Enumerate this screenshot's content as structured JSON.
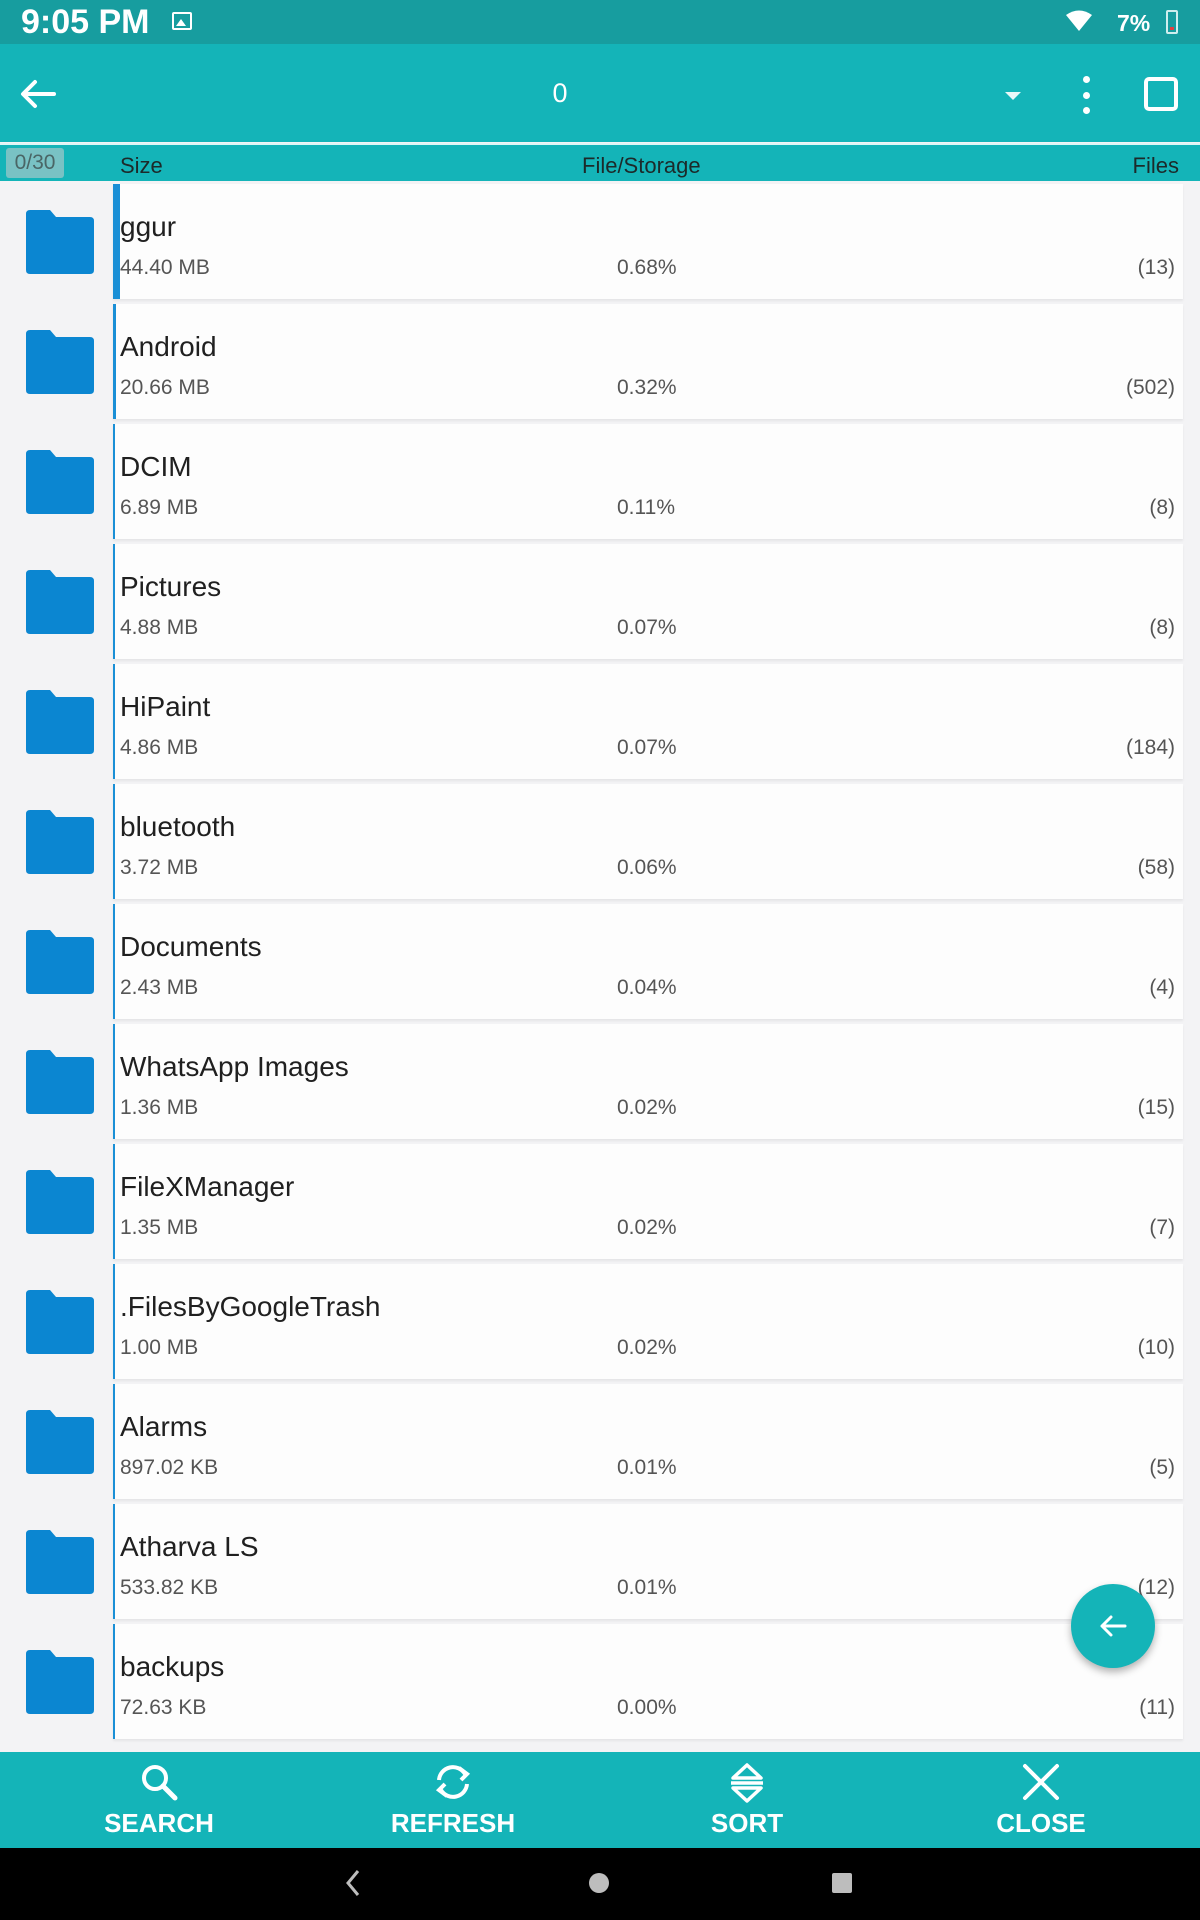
{
  "status_bar": {
    "time": "9:05 PM",
    "battery": "7%",
    "icons": [
      "image-icon",
      "wifi-icon",
      "battery-icon"
    ]
  },
  "app_bar": {
    "title": "0",
    "icons": [
      "back-arrow-icon",
      "dropdown-arrow-icon",
      "more-vert-icon",
      "select-all-checkbox-icon"
    ]
  },
  "column_header": {
    "selection_count": "0/30",
    "size": "Size",
    "storage": "File/Storage",
    "files": "Files"
  },
  "colors": {
    "accent": "#14b4b8",
    "folder": "#0b86d1",
    "usage_bar": "#1a8fd6"
  },
  "rows": [
    {
      "name": "ggur",
      "size": "44.40 MB",
      "percent": "0.68%",
      "files": "(13)",
      "usage_fraction": 0.0068
    },
    {
      "name": "Android",
      "size": "20.66 MB",
      "percent": "0.32%",
      "files": "(502)",
      "usage_fraction": 0.0032
    },
    {
      "name": "DCIM",
      "size": "6.89 MB",
      "percent": "0.11%",
      "files": "(8)",
      "usage_fraction": 0.0011
    },
    {
      "name": "Pictures",
      "size": "4.88 MB",
      "percent": "0.07%",
      "files": "(8)",
      "usage_fraction": 0.0007
    },
    {
      "name": "HiPaint",
      "size": "4.86 MB",
      "percent": "0.07%",
      "files": "(184)",
      "usage_fraction": 0.0007
    },
    {
      "name": "bluetooth",
      "size": "3.72 MB",
      "percent": "0.06%",
      "files": "(58)",
      "usage_fraction": 0.0006
    },
    {
      "name": "Documents",
      "size": "2.43 MB",
      "percent": "0.04%",
      "files": "(4)",
      "usage_fraction": 0.0004
    },
    {
      "name": "WhatsApp Images",
      "size": "1.36 MB",
      "percent": "0.02%",
      "files": "(15)",
      "usage_fraction": 0.0002
    },
    {
      "name": "FileXManager",
      "size": "1.35 MB",
      "percent": "0.02%",
      "files": "(7)",
      "usage_fraction": 0.0002
    },
    {
      "name": ".FilesByGoogleTrash",
      "size": "1.00 MB",
      "percent": "0.02%",
      "files": "(10)",
      "usage_fraction": 0.0002
    },
    {
      "name": "Alarms",
      "size": "897.02 KB",
      "percent": "0.01%",
      "files": "(5)",
      "usage_fraction": 0.0001
    },
    {
      "name": "Atharva LS",
      "size": "533.82 KB",
      "percent": "0.01%",
      "files": "(12)",
      "usage_fraction": 0.0001
    },
    {
      "name": "backups",
      "size": "72.63 KB",
      "percent": "0.00%",
      "files": "(11)",
      "usage_fraction": 0.0
    }
  ],
  "fab": {
    "icon": "back-arrow-icon"
  },
  "bottom_bar": {
    "buttons": [
      {
        "label": "SEARCH",
        "icon": "search-icon"
      },
      {
        "label": "REFRESH",
        "icon": "refresh-icon"
      },
      {
        "label": "SORT",
        "icon": "sort-icon"
      },
      {
        "label": "CLOSE",
        "icon": "close-icon"
      }
    ]
  },
  "nav_bar": {
    "icons": [
      "nav-back-icon",
      "nav-home-icon",
      "nav-recents-icon"
    ]
  }
}
